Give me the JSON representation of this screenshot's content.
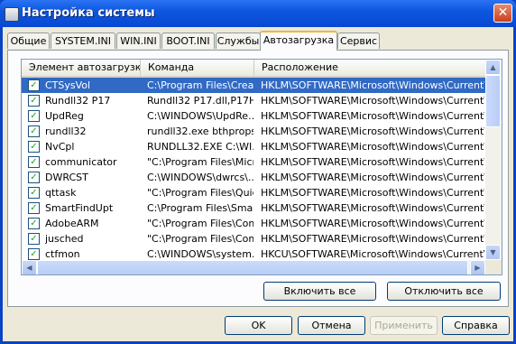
{
  "window": {
    "title": "Настройка системы",
    "close_glyph": "✕"
  },
  "tabs": [
    {
      "label": "Общие"
    },
    {
      "label": "SYSTEM.INI"
    },
    {
      "label": "WIN.INI"
    },
    {
      "label": "BOOT.INI"
    },
    {
      "label": "Службы"
    },
    {
      "label": "Автозагрузка",
      "active": true
    },
    {
      "label": "Сервис"
    }
  ],
  "list": {
    "columns": [
      "Элемент автозагрузки",
      "Команда",
      "Расположение"
    ],
    "rows": [
      {
        "item": "CTSysVol",
        "command": "C:\\Program Files\\Crea...",
        "location": "HKLM\\SOFTWARE\\Microsoft\\Windows\\CurrentVer...",
        "checked": true,
        "selected": true
      },
      {
        "item": "Rundll32 P17",
        "command": "Rundll32 P17.dll,P17H...",
        "location": "HKLM\\SOFTWARE\\Microsoft\\Windows\\CurrentVer...",
        "checked": true
      },
      {
        "item": "UpdReg",
        "command": "C:\\WINDOWS\\UpdRe...",
        "location": "HKLM\\SOFTWARE\\Microsoft\\Windows\\CurrentVer...",
        "checked": true
      },
      {
        "item": "rundll32",
        "command": "rundll32.exe bthprops...",
        "location": "HKLM\\SOFTWARE\\Microsoft\\Windows\\CurrentVer...",
        "checked": true
      },
      {
        "item": "NvCpl",
        "command": "RUNDLL32.EXE C:\\WI...",
        "location": "HKLM\\SOFTWARE\\Microsoft\\Windows\\CurrentVer...",
        "checked": true
      },
      {
        "item": "communicator",
        "command": "\"C:\\Program Files\\Micr...",
        "location": "HKLM\\SOFTWARE\\Microsoft\\Windows\\CurrentVer...",
        "checked": true
      },
      {
        "item": "DWRCST",
        "command": "C:\\WINDOWS\\dwrcs\\...",
        "location": "HKLM\\SOFTWARE\\Microsoft\\Windows\\CurrentVer...",
        "checked": true
      },
      {
        "item": "qttask",
        "command": "\"C:\\Program Files\\Quic...",
        "location": "HKLM\\SOFTWARE\\Microsoft\\Windows\\CurrentVer...",
        "checked": true
      },
      {
        "item": "SmartFindUpt",
        "command": "C:\\Program Files\\Smar...",
        "location": "HKLM\\SOFTWARE\\Microsoft\\Windows\\CurrentVer...",
        "checked": true
      },
      {
        "item": "AdobeARM",
        "command": "\"C:\\Program Files\\Com...",
        "location": "HKLM\\SOFTWARE\\Microsoft\\Windows\\CurrentVer...",
        "checked": true
      },
      {
        "item": "jusched",
        "command": "\"C:\\Program Files\\Com...",
        "location": "HKLM\\SOFTWARE\\Microsoft\\Windows\\CurrentVer...",
        "checked": true
      },
      {
        "item": "ctfmon",
        "command": "C:\\WINDOWS\\system...",
        "location": "HKCU\\SOFTWARE\\Microsoft\\Windows\\CurrentVer...",
        "checked": true
      }
    ],
    "check_glyph": "✓"
  },
  "panel_buttons": {
    "enable_all": "Включить все",
    "disable_all": "Отключить все"
  },
  "dialog_buttons": {
    "ok": "OK",
    "cancel": "Отмена",
    "apply": "Применить",
    "help": "Справка"
  },
  "colors": {
    "titlebar": "#0d57e0",
    "selection": "#316ac5",
    "dialog_bg": "#ece9d8",
    "check": "#21a121"
  }
}
